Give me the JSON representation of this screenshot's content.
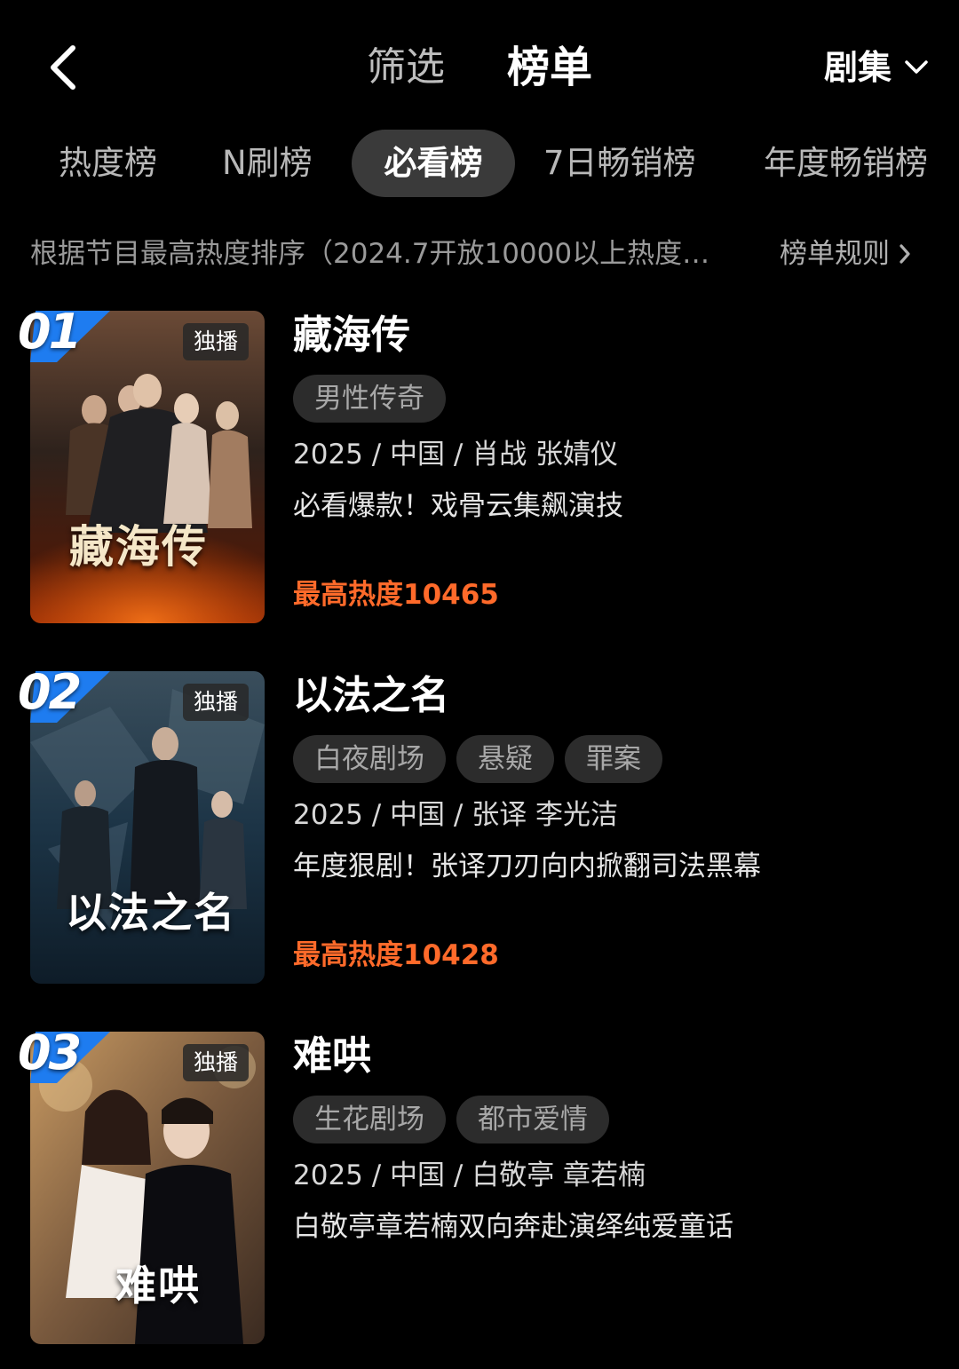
{
  "header": {
    "tabs": [
      {
        "label": "筛选"
      },
      {
        "label": "榜单"
      }
    ],
    "category_label": "剧集"
  },
  "rank_tabs": [
    {
      "label": "热度榜"
    },
    {
      "label": "N刷榜"
    },
    {
      "label": "必看榜"
    },
    {
      "label": "7日畅销榜"
    },
    {
      "label": "年度畅销榜"
    }
  ],
  "rule": {
    "description": "根据节目最高热度排序（2024.7开放10000以上热度…",
    "link_label": "榜单规则"
  },
  "items": [
    {
      "rank": "01",
      "badge": "独播",
      "poster_text": "藏海传",
      "title": "藏海传",
      "tags": [
        "男性传奇"
      ],
      "meta": "2025 / 中国 / 肖战 张婧仪",
      "desc": "必看爆款！戏骨云集飙演技",
      "heat": "最高热度10465"
    },
    {
      "rank": "02",
      "badge": "独播",
      "poster_text": "以法之名",
      "title": "以法之名",
      "tags": [
        "白夜剧场",
        "悬疑",
        "罪案"
      ],
      "meta": "2025 / 中国 / 张译 李光洁",
      "desc": "年度狠剧！张译刀刃向内掀翻司法黑幕",
      "heat": "最高热度10428"
    },
    {
      "rank": "03",
      "badge": "独播",
      "poster_text": "难哄",
      "title": "难哄",
      "tags": [
        "生花剧场",
        "都市爱情"
      ],
      "meta": "2025 / 中国 / 白敬亭 章若楠",
      "desc": "白敬亭章若楠双向奔赴演绎纯爱童话"
    }
  ],
  "colors": {
    "background": "#000000",
    "accent_heat": "#ff6a2a",
    "rank_badge": "#1e7cf0",
    "tab_active_bg": "#3a3a3a",
    "tag_bg": "#2c2c2c"
  },
  "icons": [
    "back-arrow-icon",
    "chevron-down-icon",
    "chevron-right-icon"
  ]
}
